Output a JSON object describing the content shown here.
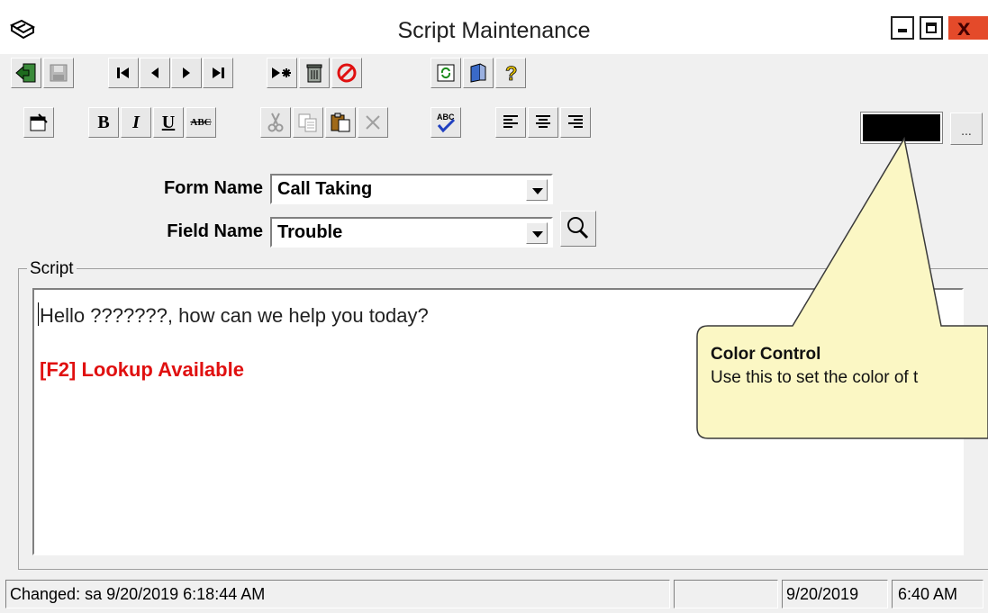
{
  "window": {
    "title": "Script Maintenance",
    "close_glyph": "x"
  },
  "icons": {
    "nav_toolbar": [
      "exit-icon",
      "save-icon",
      "first-record-icon",
      "previous-record-icon",
      "next-record-icon",
      "last-record-icon",
      "new-record-icon",
      "delete-icon",
      "cancel-icon",
      "refresh-icon",
      "print-icon",
      "help-icon"
    ],
    "format_toolbar": [
      "properties-icon",
      "bold-icon",
      "italic-icon",
      "underline-icon",
      "strikethrough-icon",
      "cut-icon",
      "copy-icon",
      "paste-icon",
      "clear-icon",
      "spellcheck-icon",
      "align-left-icon",
      "align-center-icon",
      "align-right-icon"
    ]
  },
  "format": {
    "bold": "B",
    "italic": "I",
    "underline": "U",
    "strike": "ABC",
    "color_value": "#000000",
    "more_label": "..."
  },
  "form": {
    "form_name_label": "Form Name",
    "form_name_value": "Call Taking",
    "field_name_label": "Field Name",
    "field_name_value": "Trouble"
  },
  "script": {
    "group_label": "Script",
    "line1": "Hello ???????, how can we help you today?",
    "line2": "[F2] Lookup Available",
    "line2_color": "#e01010"
  },
  "callout": {
    "title": "Color Control",
    "body": "Use this to set the color of t",
    "fill": "#fbf7c4",
    "stroke": "#3a3a3a"
  },
  "status": {
    "changed": "Changed: sa 9/20/2019 6:18:44 AM",
    "empty": "",
    "date": "9/20/2019",
    "time": "6:40 AM"
  }
}
